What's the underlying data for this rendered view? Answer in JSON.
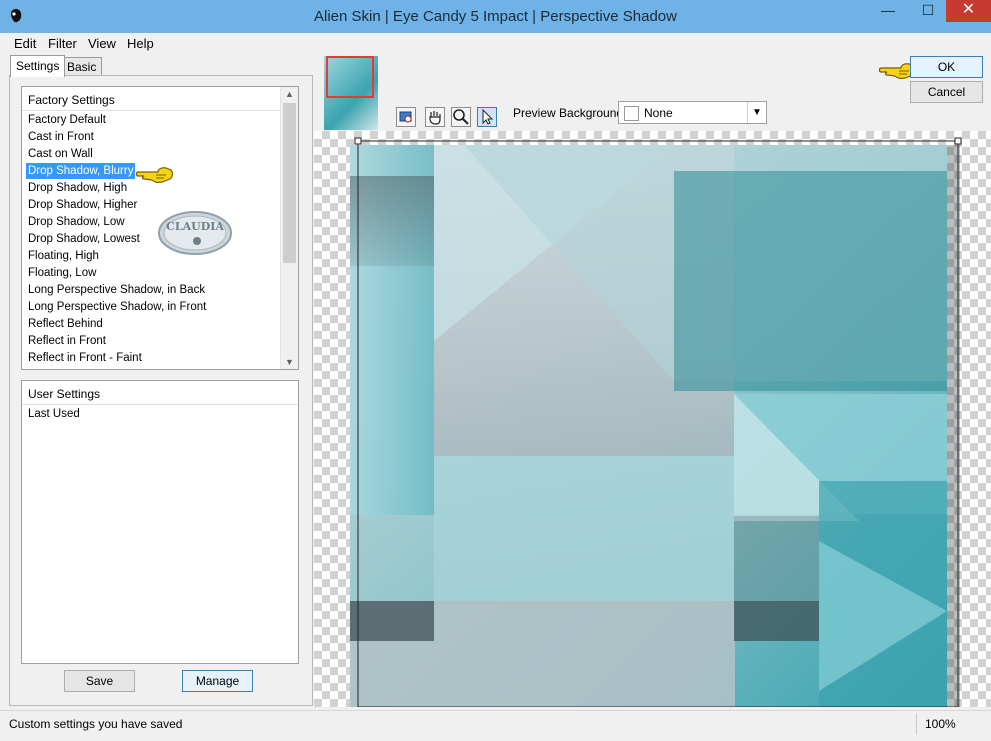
{
  "window": {
    "title": "Alien Skin | Eye Candy 5 Impact | Perspective Shadow",
    "minimize_glyph": "—",
    "maximize_glyph": "☐",
    "close_glyph": "✕"
  },
  "menu": [
    "Edit",
    "Filter",
    "View",
    "Help"
  ],
  "tabs": [
    {
      "label": "Settings",
      "active": true
    },
    {
      "label": "Basic",
      "active": false
    }
  ],
  "factory_settings": {
    "header": "Factory Settings",
    "selected_index": 3,
    "items": [
      "Factory Default",
      "Cast in Front",
      "Cast on Wall",
      "Drop Shadow, Blurry",
      "Drop Shadow, High",
      "Drop Shadow, Higher",
      "Drop Shadow, Low",
      "Drop Shadow, Lowest",
      "Floating, High",
      "Floating, Low",
      "Long Perspective Shadow, in Back",
      "Long Perspective Shadow, in Front",
      "Reflect Behind",
      "Reflect in Front",
      "Reflect in Front - Faint"
    ]
  },
  "user_settings": {
    "header": "User Settings",
    "items": [
      "Last Used"
    ]
  },
  "buttons": {
    "save": "Save",
    "manage": "Manage",
    "ok": "OK",
    "cancel": "Cancel"
  },
  "preview_background": {
    "label": "Preview Background:",
    "value": "None"
  },
  "watermark": "CLAUDIA",
  "status": {
    "message": "Custom settings you have saved",
    "zoom": "100%"
  },
  "icons": [
    "app-icon",
    "navigate-tool-icon",
    "hand-tool-icon",
    "zoom-tool-icon",
    "pointer-tool-icon",
    "pointing-hand-icon"
  ],
  "colors": {
    "titlebar": "#6fb3e6",
    "close_button": "#c73a2f",
    "selection": "#3399ff",
    "preview_teal": "#3ba3ae",
    "pointer_yellow": "#f5d31a"
  }
}
